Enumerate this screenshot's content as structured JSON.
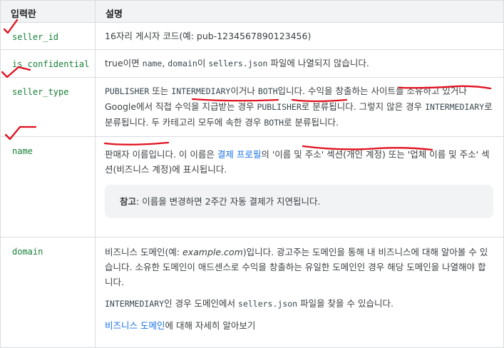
{
  "header": {
    "field": "입력란",
    "desc": "설명"
  },
  "rows": {
    "seller_id": {
      "name": "seller_id",
      "d1": "16자리 게시자 코드(예: pub-1234567890123456)"
    },
    "is_confidential": {
      "name": "is_confidential",
      "d1": "true이면 ",
      "c1": "name",
      "d2": ", ",
      "c2": "domain",
      "d3": "이 ",
      "c3": "sellers.json",
      "d4": " 파일에 나열되지 않습니다."
    },
    "seller_type": {
      "name": "seller_type",
      "c1": "PUBLISHER",
      "d1": " 또는 ",
      "c2": "INTERMEDIARY",
      "d2": "이거나 ",
      "c3": "BOTH",
      "d3": "입니다. 수익을 창출하는 사이트를 소유하고 있거나 Google에서 직접 수익을 지급받는 경우 ",
      "c4": "PUBLISHER",
      "d4": "로 분류됩니다. 그렇지 않은 경우 ",
      "c5": "INTERMEDIARY",
      "d5": "로 분류됩니다. 두 카테고리 모두에 속한 경우 ",
      "c6": "BOTH",
      "d6": "로 분류됩니다."
    },
    "name": {
      "name": "name",
      "d1": "판매자 이름입니다. 이 이름은 ",
      "link": "결제 프로필",
      "d2": "의 '이름 및 주소' 섹션(개인 계정) 또는 '업체 이름 및 주소' 섹션(비즈니스 계정)에 표시됩니다.",
      "note_label": "참고",
      "note_text": ": 이름을 변경하면 2주간 자동 결제가 지연됩니다."
    },
    "domain": {
      "name": "domain",
      "p1a": "비즈니스 도메인(예: ",
      "p1i": "example.com",
      "p1b": ")입니다. 광고주는 도메인을 통해 내 비즈니스에 대해 알아볼 수 있습니다. 소유한 도메인이 애드센스로 수익을 창출하는 유일한 도메인인 경우 해당 도메인을 나열해야 합니다.",
      "p2c1": "INTERMEDIARY",
      "p2a": "인 경우 도메인에서 ",
      "p2c2": "sellers.json",
      "p2b": " 파일을 찾을 수 있습니다.",
      "p3link": "비즈니스 도메인",
      "p3": "에 대해 자세히 알아보기"
    }
  },
  "colors": {
    "ink_marks": "#e0101e",
    "link": "#1a73e8",
    "code": "#188038"
  }
}
